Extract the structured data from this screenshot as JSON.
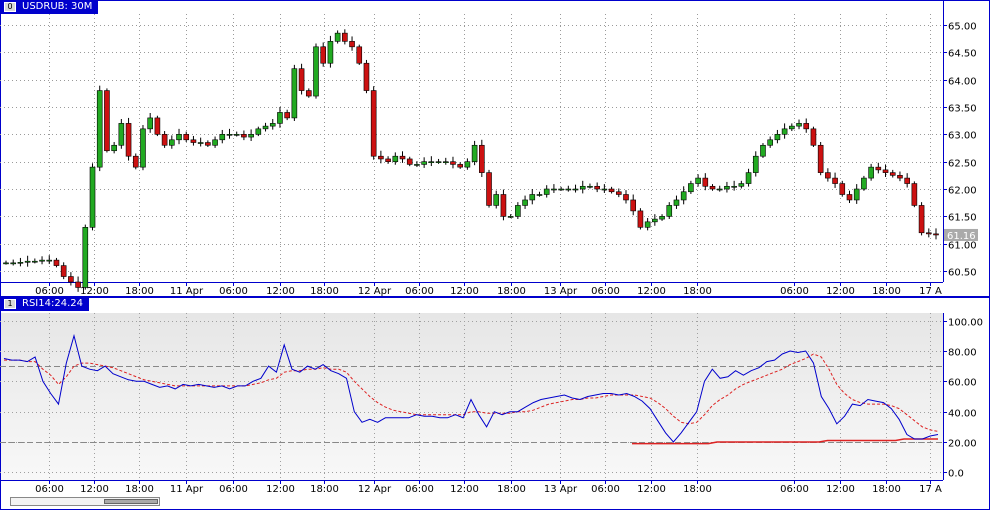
{
  "main_panel": {
    "title": "USDRUB: 30M",
    "icon_glyph": "0",
    "price_axis_labels": [
      "65.00",
      "64.50",
      "64.00",
      "63.50",
      "63.00",
      "62.50",
      "62.00",
      "61.50",
      "61.00",
      "60.50"
    ],
    "last_price": "61.16",
    "time_labels": [
      "06:00",
      "12:00",
      "18:00",
      "11 Apr",
      "06:00",
      "12:00",
      "18:00",
      "12 Apr",
      "06:00",
      "12:00",
      "18:00",
      "13 Apr",
      "06:00",
      "12:00",
      "18:00",
      "06:00",
      "12:00",
      "18:00",
      "17 A"
    ]
  },
  "rsi_panel": {
    "title": "RSI14:24.24",
    "icon_glyph": "1",
    "axis_labels": [
      "100.00",
      "80.00",
      "60.00",
      "40.00",
      "20.00",
      "0.0"
    ],
    "time_labels": [
      "06:00",
      "12:00",
      "18:00",
      "11 Apr",
      "06:00",
      "12:00",
      "18:00",
      "12 Apr",
      "06:00",
      "12:00",
      "18:00",
      "13 Apr",
      "06:00",
      "12:00",
      "18:00",
      "06:00",
      "12:00",
      "18:00",
      "17 A"
    ]
  },
  "colors": {
    "frame": "#0000cc",
    "bull": "#22aa22",
    "bear": "#cc1111",
    "rsi_line": "#0000cc",
    "rsi_signal": "#dd2222",
    "level_line": "#888888"
  },
  "chart_data": [
    {
      "type": "candlestick",
      "title": "USDRUB: 30M",
      "ylim": [
        60.3,
        65.2
      ],
      "x_labels": [
        "06:00",
        "12:00",
        "18:00",
        "11 Apr",
        "06:00",
        "12:00",
        "18:00",
        "12 Apr",
        "06:00",
        "12:00",
        "18:00",
        "13 Apr",
        "06:00",
        "12:00",
        "18:00",
        "06:00",
        "12:00",
        "18:00",
        "17 A"
      ],
      "close_path": [
        60.65,
        60.65,
        60.66,
        60.68,
        60.68,
        60.7,
        60.7,
        60.6,
        60.4,
        60.3,
        60.2,
        61.3,
        62.4,
        63.8,
        62.7,
        62.8,
        63.2,
        62.6,
        62.4,
        63.1,
        63.3,
        63.0,
        62.8,
        62.9,
        63.0,
        62.9,
        62.85,
        62.85,
        62.8,
        62.9,
        63.0,
        63.0,
        63.0,
        62.95,
        63.0,
        63.1,
        63.15,
        63.2,
        63.4,
        63.3,
        64.2,
        63.8,
        63.7,
        64.6,
        64.3,
        64.7,
        64.85,
        64.7,
        64.6,
        64.3,
        63.8,
        62.6,
        62.55,
        62.5,
        62.6,
        62.55,
        62.45,
        62.45,
        62.5,
        62.5,
        62.5,
        62.5,
        62.45,
        62.4,
        62.5,
        62.8,
        62.3,
        61.7,
        61.9,
        61.5,
        61.5,
        61.7,
        61.8,
        61.9,
        61.9,
        62.0,
        62.0,
        62.0,
        62.0,
        62.0,
        62.05,
        62.05,
        62.0,
        62.0,
        61.95,
        61.9,
        61.8,
        61.6,
        61.3,
        61.4,
        61.45,
        61.5,
        61.7,
        61.8,
        61.95,
        62.1,
        62.2,
        62.05,
        62.0,
        62.0,
        62.05,
        62.05,
        62.1,
        62.3,
        62.6,
        62.8,
        62.9,
        63.0,
        63.1,
        63.15,
        63.2,
        63.1,
        62.8,
        62.3,
        62.2,
        62.1,
        61.9,
        61.8,
        62.0,
        62.2,
        62.4,
        62.35,
        62.3,
        62.25,
        62.2,
        62.1,
        61.7,
        61.2,
        61.18,
        61.16
      ]
    },
    {
      "type": "line",
      "title": "RSI14:24.24",
      "ylim": [
        -5,
        105
      ],
      "levels": [
        70,
        20
      ],
      "series": [
        {
          "values": [
            75,
            74,
            74,
            73,
            76,
            60,
            52,
            45,
            72,
            90,
            70,
            68,
            67,
            70,
            65,
            63,
            61,
            60,
            60,
            58,
            56,
            57,
            55,
            58,
            57,
            58,
            57,
            56,
            57,
            55,
            57,
            57,
            60,
            62,
            70,
            66,
            84,
            68,
            66,
            70,
            68,
            71,
            67,
            65,
            62,
            40,
            33,
            35,
            33,
            36,
            36,
            36,
            36,
            38,
            37,
            37,
            36,
            36,
            38,
            36,
            48,
            38,
            30,
            40,
            38,
            40,
            40,
            43,
            46,
            48,
            49,
            50,
            51,
            49,
            48,
            50,
            51,
            52,
            52,
            51,
            52,
            50,
            47,
            42,
            34,
            26,
            20,
            26,
            33,
            40,
            60,
            68,
            62,
            63,
            67,
            64,
            67,
            69,
            73,
            74,
            78,
            80,
            79,
            80,
            72,
            50,
            42,
            32,
            37,
            45,
            44,
            48,
            47,
            46,
            42,
            35,
            25,
            22,
            22,
            24,
            25
          ]
        },
        {
          "values": [
            74,
            74,
            74,
            73,
            73,
            68,
            64,
            58,
            63,
            70,
            72,
            72,
            71,
            70,
            69,
            67,
            65,
            63,
            61,
            60,
            59,
            58,
            57,
            57,
            57,
            57,
            57,
            57,
            57,
            57,
            57,
            57,
            58,
            59,
            61,
            62,
            66,
            67,
            67,
            68,
            68,
            69,
            68,
            68,
            66,
            60,
            55,
            50,
            46,
            43,
            41,
            40,
            39,
            38,
            38,
            38,
            38,
            38,
            38,
            38,
            40,
            40,
            39,
            39,
            39,
            39,
            40,
            40,
            41,
            43,
            45,
            46,
            47,
            48,
            48,
            49,
            49,
            50,
            51,
            51,
            51,
            51,
            50,
            49,
            46,
            42,
            37,
            33,
            32,
            33,
            38,
            44,
            48,
            51,
            55,
            58,
            60,
            62,
            64,
            66,
            68,
            71,
            73,
            75,
            78,
            76,
            68,
            58,
            52,
            48,
            46,
            45,
            45,
            45,
            44,
            42,
            38,
            34,
            30,
            28,
            27
          ]
        },
        {
          "values": [
            19,
            19,
            19,
            19,
            19,
            19,
            19,
            19,
            19,
            19,
            20,
            20,
            20,
            20,
            20,
            20,
            20,
            20,
            20,
            20,
            20,
            20,
            20,
            21,
            21,
            21,
            21,
            21,
            21,
            21,
            21,
            21,
            22,
            22,
            22,
            22,
            22
          ]
        }
      ]
    }
  ]
}
